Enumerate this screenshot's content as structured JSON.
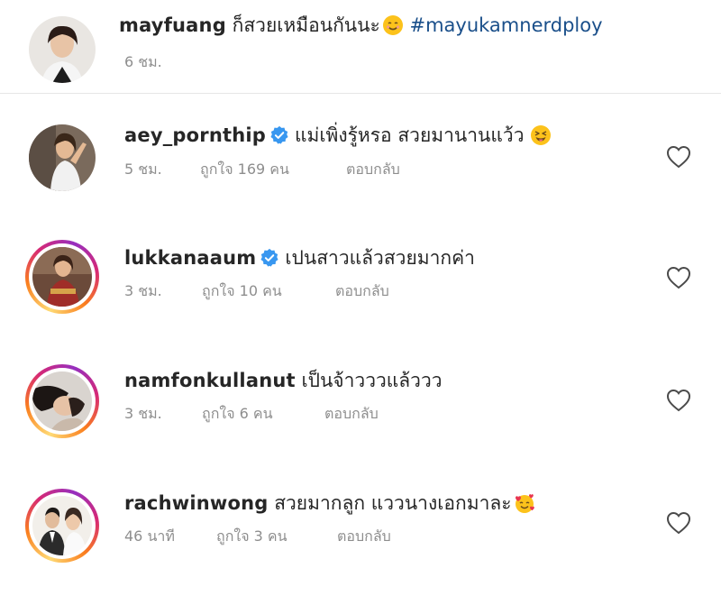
{
  "comments": [
    {
      "username": "mayfuang",
      "text": "ก็สวยเหมือนกันนะ",
      "emoji": "smiling-face-emoji",
      "hashtag": "#mayukamnerdploy",
      "time": "6 ชม.",
      "likes": "",
      "reply": ""
    },
    {
      "username": "aey_pornthip",
      "text": "แม่เพิ่งรู้หรอ สวยมานานแว้ว",
      "emoji": "tongue-wink-emoji",
      "time": "5 ชม.",
      "likes": "ถูกใจ 169 คน",
      "reply": "ตอบกลับ"
    },
    {
      "username": "lukkanaaum",
      "text": "เปนสาวแล้วสวยมากค่า",
      "time": "3 ชม.",
      "likes": "ถูกใจ 10 คน",
      "reply": "ตอบกลับ"
    },
    {
      "username": "namfonkullanut",
      "text": "เป็นจ้าวววแล้ววว",
      "time": "3 ชม.",
      "likes": "ถูกใจ 6 คน",
      "reply": "ตอบกลับ"
    },
    {
      "username": "rachwinwong",
      "text": "สวยมากลูก แววนางเอกมาละ",
      "emoji": "smiling-face-with-hearts-emoji",
      "time": "46 นาที",
      "likes": "ถูกใจ 3 คน",
      "reply": "ตอบกลับ"
    }
  ],
  "colors": {
    "text": "#262626",
    "meta": "#8e8e8e",
    "hashtag": "#1a4f8a",
    "verified": "#3897f0"
  }
}
